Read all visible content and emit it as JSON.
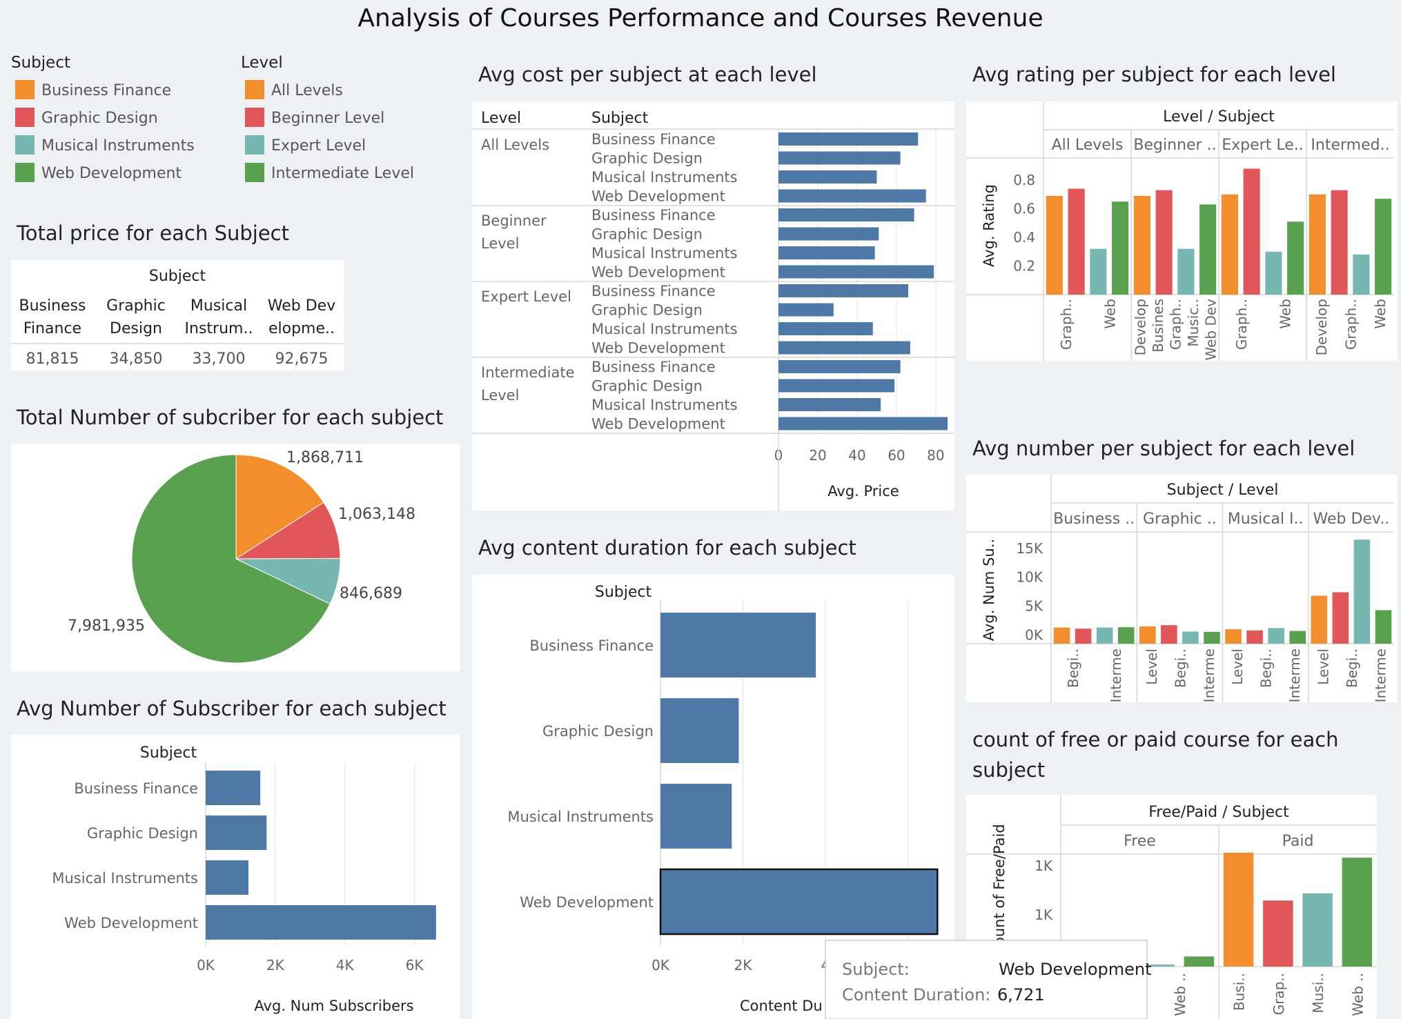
{
  "dashboard_title": "Analysis of Courses Performance and Courses Revenue",
  "colors": {
    "Business Finance": "#f28e2b",
    "Graphic Design": "#e15759",
    "Musical Instruments": "#76b7b2",
    "Web Development": "#59a14f",
    "All Levels": "#f28e2b",
    "Beginner Level": "#e15759",
    "Expert Level": "#76b7b2",
    "Intermediate Level": "#59a14f",
    "bar": "#4e79a7"
  },
  "legends": {
    "subject_title": "Subject",
    "subjects": [
      "Business Finance",
      "Graphic Design",
      "Musical Instruments",
      "Web Development"
    ],
    "level_title": "Level",
    "levels": [
      "All Levels",
      "Beginner Level",
      "Expert Level",
      "Intermediate Level"
    ]
  },
  "tooltip": {
    "subject_key": "Subject:",
    "subject_value": "Web Development",
    "duration_key": "Content Duration:",
    "duration_value": "6,721"
  },
  "chart_data": [
    {
      "id": "total_price",
      "type": "table",
      "title": "Total price for each Subject",
      "column_header": "Subject",
      "columns": [
        [
          "Business",
          "Finance"
        ],
        [
          "Graphic",
          "Design"
        ],
        [
          "Musical",
          "Instrum.."
        ],
        [
          "Web Dev",
          "elopme.."
        ]
      ],
      "values": [
        "81,815",
        "34,850",
        "33,700",
        "92,675"
      ]
    },
    {
      "id": "total_subscribers",
      "type": "pie",
      "title": "Total Number of subcriber for each subject",
      "categories": [
        "Business Finance",
        "Graphic Design",
        "Musical Instruments",
        "Web Development"
      ],
      "values": [
        1868711,
        1063148,
        846689,
        7981935
      ],
      "labels": [
        "1,868,711",
        "1,063,148",
        "846,689",
        "7,981,935"
      ]
    },
    {
      "id": "avg_subscribers",
      "type": "bar",
      "orientation": "horizontal",
      "title": "Avg Number of Subscriber for each subject",
      "row_header": "Subject",
      "categories": [
        "Business Finance",
        "Graphic Design",
        "Musical Instruments",
        "Web Development"
      ],
      "values": [
        1570,
        1750,
        1230,
        6620
      ],
      "xlabel": "Avg. Num Subscribers",
      "xlim": [
        0,
        7000
      ],
      "xticks": [
        0,
        2000,
        4000,
        6000
      ],
      "xtick_labels": [
        "0K",
        "2K",
        "4K",
        "6K"
      ]
    },
    {
      "id": "avg_cost",
      "type": "bar",
      "orientation": "horizontal",
      "title": "Avg cost per subject at each level",
      "level_header": "Level",
      "subject_header": "Subject",
      "groups": [
        {
          "level": [
            "All Levels"
          ],
          "subjects": [
            "Business Finance",
            "Graphic Design",
            "Musical Instruments",
            "Web Development"
          ],
          "values": [
            71,
            62,
            50,
            75
          ]
        },
        {
          "level": [
            "Beginner",
            "Level"
          ],
          "subjects": [
            "Business Finance",
            "Graphic Design",
            "Musical Instruments",
            "Web Development"
          ],
          "values": [
            69,
            51,
            49,
            79
          ]
        },
        {
          "level": [
            "Expert Level"
          ],
          "subjects": [
            "Business Finance",
            "Graphic Design",
            "Musical Instruments",
            "Web Development"
          ],
          "values": [
            66,
            28,
            48,
            67
          ]
        },
        {
          "level": [
            "Intermediate",
            "Level"
          ],
          "subjects": [
            "Business Finance",
            "Graphic Design",
            "Musical Instruments",
            "Web Development"
          ],
          "values": [
            62,
            59,
            52,
            86
          ]
        }
      ],
      "xlabel": "Avg. Price",
      "xlim": [
        0,
        86
      ],
      "xticks": [
        0,
        20,
        40,
        60,
        80
      ]
    },
    {
      "id": "avg_duration",
      "type": "bar",
      "orientation": "horizontal",
      "title": "Avg content duration for each subject",
      "row_header": "Subject",
      "categories": [
        "Business Finance",
        "Graphic Design",
        "Musical Instruments",
        "Web Development"
      ],
      "values": [
        3770,
        1900,
        1730,
        6721
      ],
      "xlabel": "Content Du",
      "xlim": [
        0,
        6850
      ],
      "xticks": [
        0,
        2000,
        4000
      ],
      "xtick_labels": [
        "0K",
        "2K",
        "4"
      ]
    },
    {
      "id": "avg_rating",
      "type": "bar",
      "title": "Avg rating per subject for each level",
      "column_header": "Level / Subject",
      "panels": [
        "All Levels",
        "Beginner ..",
        "Expert Le..",
        "Intermed.."
      ],
      "series_order": [
        "Business Finance",
        "Graphic Design",
        "Musical Instruments",
        "Web Development"
      ],
      "values": [
        [
          0.69,
          0.74,
          0.32,
          0.65
        ],
        [
          0.69,
          0.73,
          0.32,
          0.63
        ],
        [
          0.7,
          0.88,
          0.3,
          0.51
        ],
        [
          0.7,
          0.73,
          0.28,
          0.67
        ]
      ],
      "x_tick_labels": [
        [
          "Graph..",
          "Web"
        ],
        [
          "Develop",
          "Busines",
          "Graph..",
          "Music..",
          "Web Dev"
        ],
        [
          "Graph..",
          "Web"
        ],
        [
          "Develop",
          "Graph..",
          "Web"
        ]
      ],
      "ylabel": "Avg. Rating",
      "ylim": [
        0,
        0.95
      ],
      "yticks": [
        0.2,
        0.4,
        0.6,
        0.8
      ]
    },
    {
      "id": "avg_number",
      "type": "bar",
      "title": "Avg number per subject for each level",
      "column_header": "Subject / Level",
      "panels": [
        "Business ..",
        "Graphic ..",
        "Musical I..",
        "Web Dev.."
      ],
      "series_order": [
        "All Levels",
        "Beginner Level",
        "Expert Level",
        "Intermediate Level"
      ],
      "values": [
        [
          1300,
          1100,
          1300,
          1350
        ],
        [
          1500,
          1700,
          600,
          550
        ],
        [
          1000,
          800,
          1200,
          700
        ],
        [
          6800,
          7400,
          16500,
          4300
        ]
      ],
      "x_tick_labels": [
        [
          "Begi..",
          "Interme"
        ],
        [
          "Level",
          "Begi..",
          "Interme"
        ],
        [
          "Level",
          "Begi..",
          "Interme"
        ],
        [
          "Level",
          "Begi..",
          "Interme"
        ]
      ],
      "ylabel": "Avg. Num Su..",
      "ylim": [
        -1500,
        17000
      ],
      "yticks": [
        0,
        5000,
        10000,
        15000
      ],
      "ytick_labels": [
        "0K",
        "5K",
        "10K",
        "15K"
      ]
    },
    {
      "id": "free_paid",
      "type": "bar",
      "title": [
        "count of free or paid course for each",
        "subject"
      ],
      "column_header": "Free/Paid / Subject",
      "panels": [
        "Free",
        "Paid"
      ],
      "series_order": [
        "Business Finance",
        "Graphic Design",
        "Musical Instruments",
        "Web Development"
      ],
      "values": [
        [
          null,
          null,
          20,
          100
        ],
        [
          1130,
          655,
          726,
          1080
        ]
      ],
      "x_tick_labels": [
        [
          "Musi..",
          "Web .."
        ],
        [
          "Busi..",
          "Grap..",
          "Musi..",
          "Web .."
        ]
      ],
      "ylabel": "Count of Free/Paid",
      "yticks": [
        1000,
        1000
      ],
      "ytick_labels": [
        "1K",
        "1K"
      ]
    }
  ]
}
